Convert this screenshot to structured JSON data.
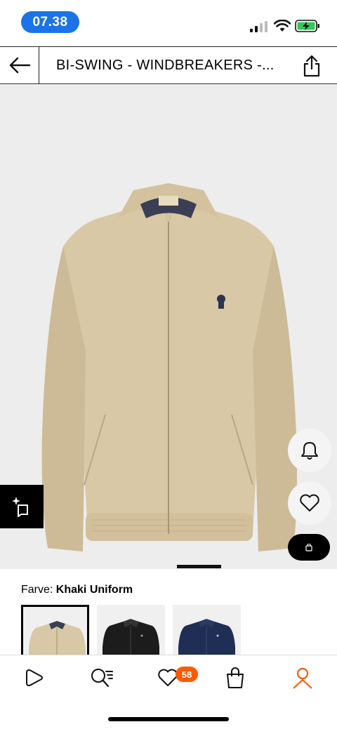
{
  "status_bar": {
    "time": "07.38",
    "signal_icon": "cellular-signal-icon",
    "wifi_icon": "wifi-icon",
    "battery_icon": "battery-charging-icon"
  },
  "header": {
    "title": "BI-SWING - WINDBREAKERS -...",
    "back_icon": "arrow-left-icon",
    "share_icon": "share-icon"
  },
  "product": {
    "image_desc_icon": "jacket-image",
    "image_label_tag": "POLO RALPH LAUREN",
    "actions": {
      "notify_icon": "bell-icon",
      "wishlist_icon": "heart-icon",
      "bag_icon": "shopping-bag-icon",
      "visual_search_icon": "visual-search-icon"
    }
  },
  "color": {
    "label": "Farve:",
    "value": "Khaki Uniform",
    "swatches": [
      "khaki",
      "black",
      "navy"
    ]
  },
  "bottom_nav": {
    "items": [
      "play-icon",
      "search-icon",
      "heart-icon",
      "bag-icon",
      "profile-icon"
    ],
    "wishlist_count": "58",
    "active_color": "#ff5a00"
  }
}
